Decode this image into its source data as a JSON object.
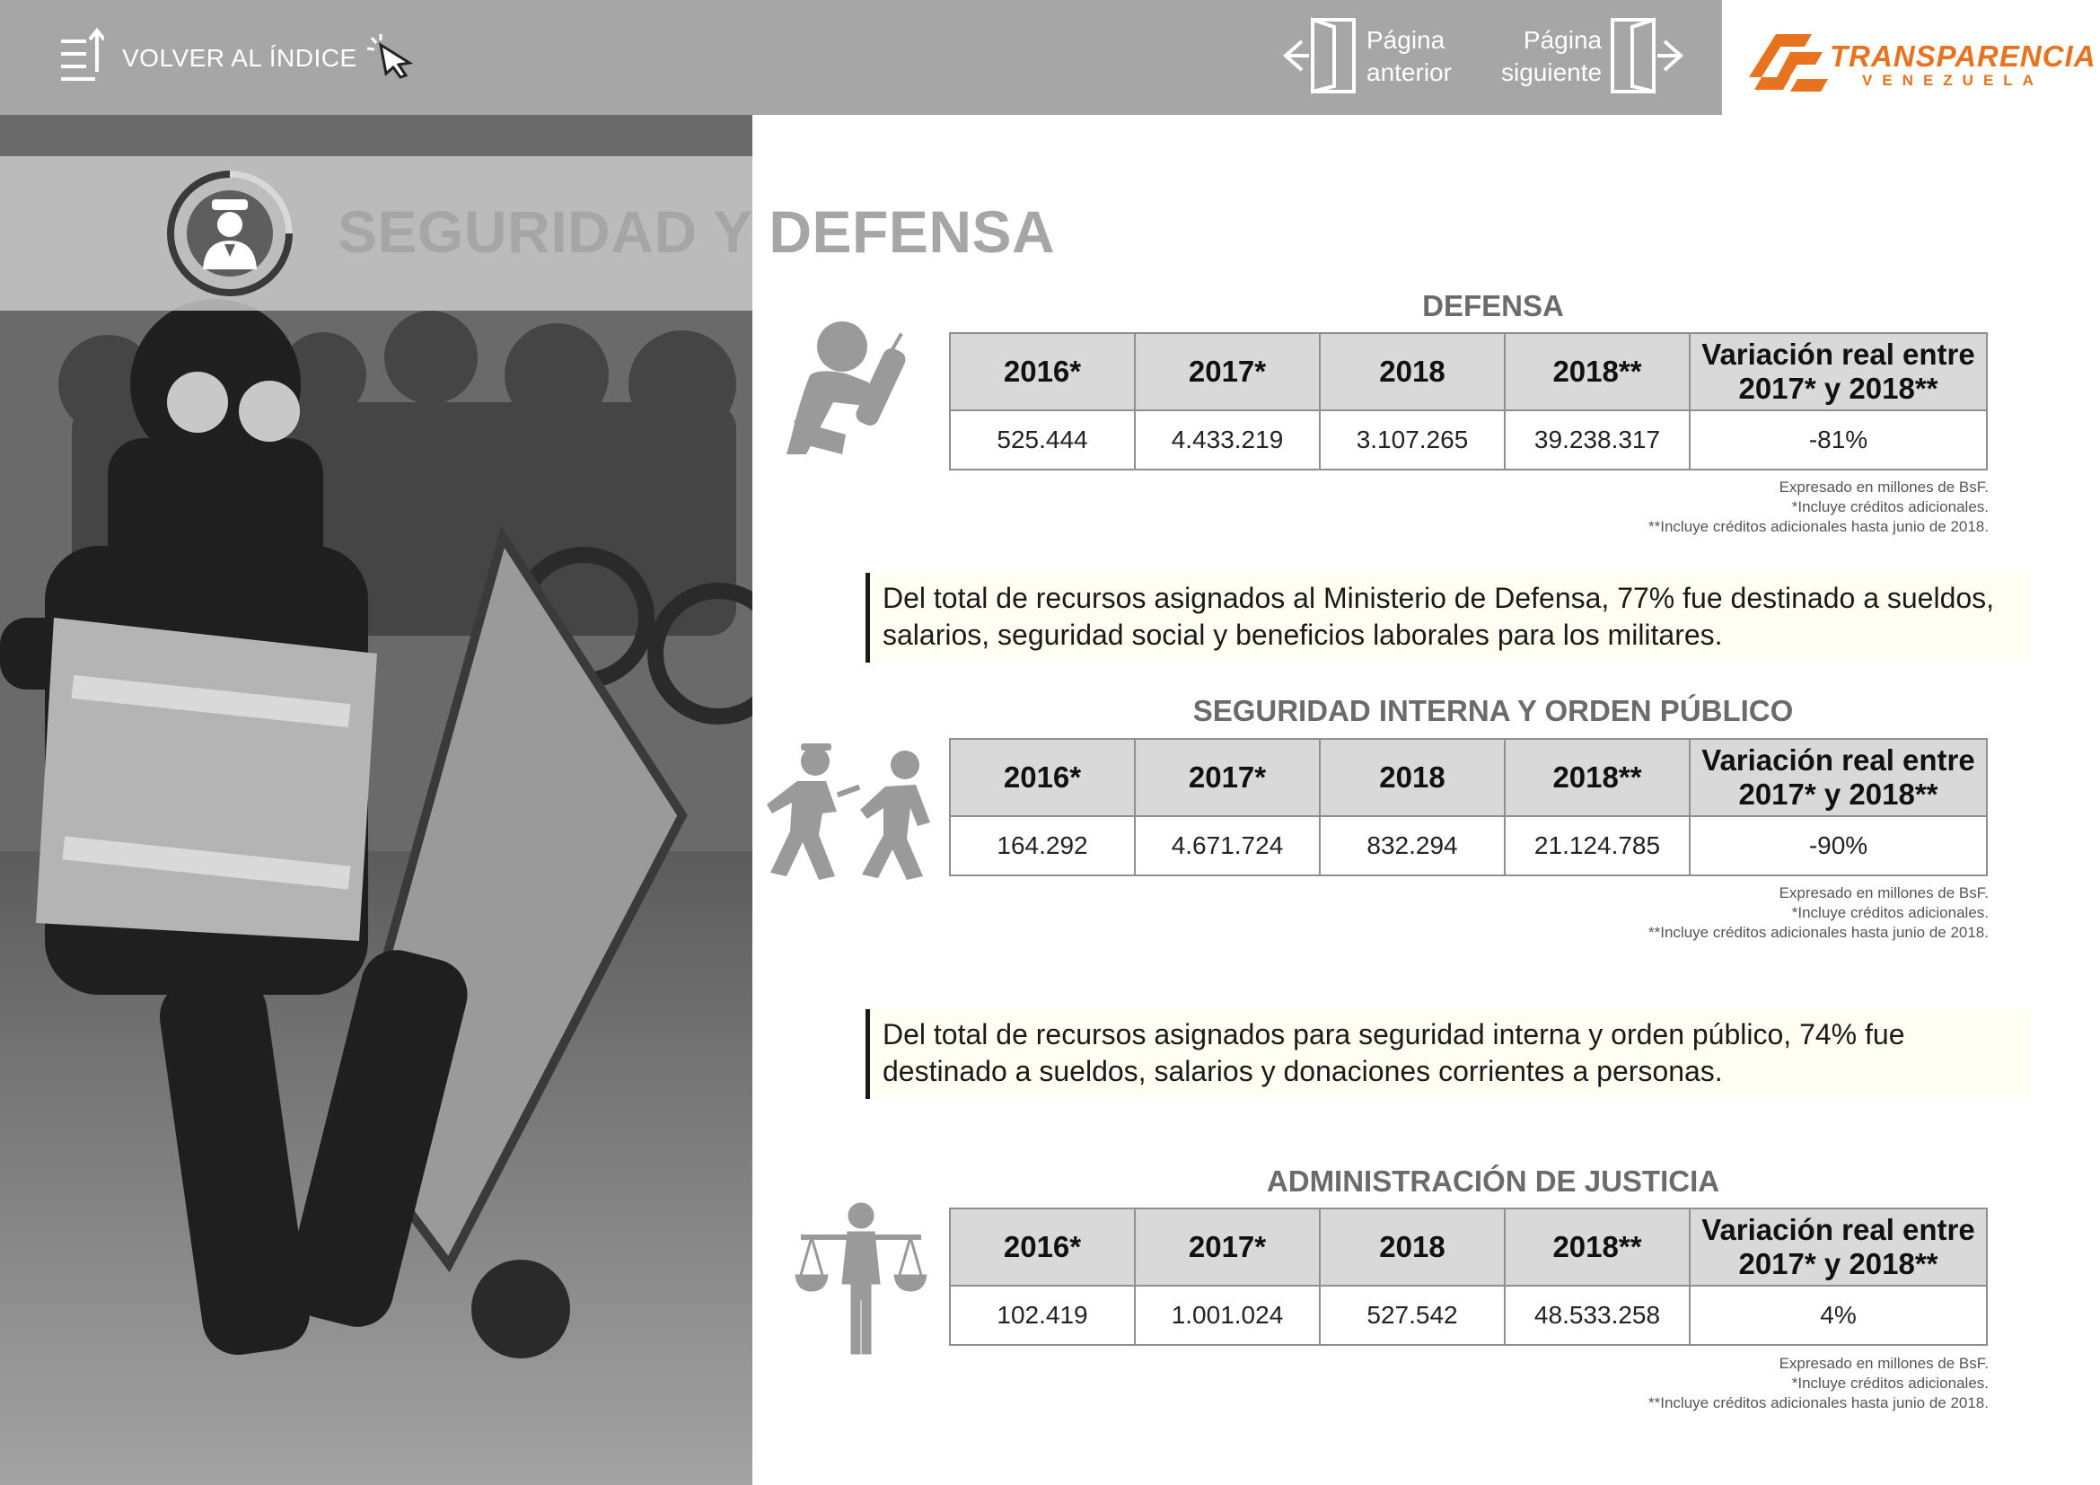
{
  "nav": {
    "back_label": "VOLVER AL ÍNDICE",
    "prev_line1": "Página",
    "prev_line2": "anterior",
    "next_line1": "Página",
    "next_line2": "siguiente"
  },
  "logo": {
    "main": "TRANSPARENCIA",
    "sub": "VENEZUELA",
    "color": "#e8731f"
  },
  "page_title": "SEGURIDAD Y DEFENSA",
  "sections": [
    {
      "title": "DEFENSA",
      "headers": [
        "2016*",
        "2017*",
        "2018",
        "2018**",
        "Variación real entre 2017* y 2018**"
      ],
      "values": [
        "525.444",
        "4.433.219",
        "3.107.265",
        "39.238.317",
        "-81%"
      ],
      "notes": [
        "Expresado en millones de BsF.",
        "*Incluye créditos adicionales.",
        "**Incluye créditos adicionales hasta junio de 2018."
      ]
    },
    {
      "title": "SEGURIDAD INTERNA Y ORDEN PÚBLICO",
      "headers": [
        "2016*",
        "2017*",
        "2018",
        "2018**",
        "Variación real entre 2017* y 2018**"
      ],
      "values": [
        "164.292",
        "4.671.724",
        "832.294",
        "21.124.785",
        "-90%"
      ],
      "notes": [
        "Expresado en millones de BsF.",
        "*Incluye créditos adicionales.",
        "**Incluye créditos adicionales hasta junio de 2018."
      ]
    },
    {
      "title": "ADMINISTRACIÓN DE JUSTICIA",
      "headers": [
        "2016*",
        "2017*",
        "2018",
        "2018**",
        "Variación real entre 2017* y 2018**"
      ],
      "values": [
        "102.419",
        "1.001.024",
        "527.542",
        "48.533.258",
        "4%"
      ],
      "notes": [
        "Expresado en millones de BsF.",
        "*Incluye créditos adicionales.",
        "**Incluye créditos adicionales hasta junio de 2018."
      ]
    }
  ],
  "callouts": [
    "Del total de recursos asignados al Ministerio de Defensa, 77% fue destinado a sueldos, salarios, seguridad social y beneficios laborales para los militares.",
    "Del total de recursos asignados para seguridad interna y orden público, 74% fue destinado a sueldos, salarios y donaciones corrientes a personas."
  ],
  "icons": {
    "back": "index-list-icon",
    "cursor": "hand-pointer-icon",
    "prev": "door-left-icon",
    "next": "door-right-icon",
    "title": "police-officer-icon",
    "defensa": "soldier-icon",
    "seguridad": "police-chase-icon",
    "justicia": "justice-scales-icon"
  }
}
